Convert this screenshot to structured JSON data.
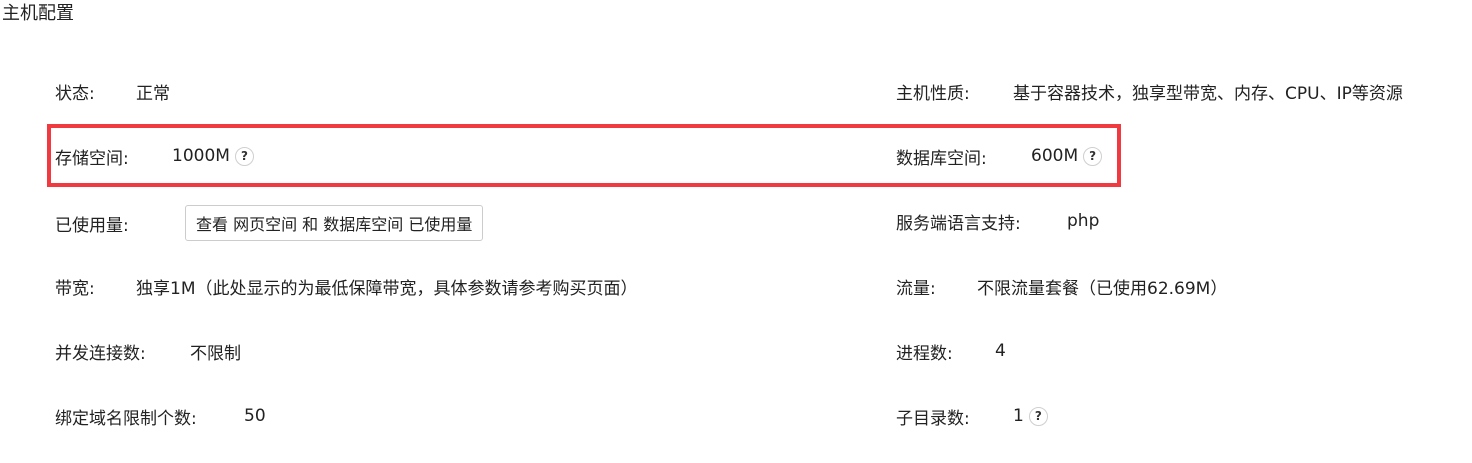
{
  "section": {
    "title": "主机配置"
  },
  "left": {
    "status": {
      "label": "状态:",
      "value": "正常"
    },
    "storage": {
      "label": "存储空间:",
      "value": "1000M",
      "help": "?"
    },
    "usage": {
      "label": "已使用量:",
      "button_label": "查看 网页空间 和 数据库空间 已使用量"
    },
    "bandwidth": {
      "label": "带宽:",
      "value": "独享1M（此处显示的为最低保障带宽，具体参数请参考购买页面）"
    },
    "concurrency": {
      "label": "并发连接数:",
      "value": "不限制"
    },
    "domains": {
      "label": "绑定域名限制个数:",
      "value": "50"
    }
  },
  "right": {
    "host_type": {
      "label": "主机性质:",
      "value": "基于容器技术，独享型带宽、内存、CPU、IP等资源"
    },
    "database": {
      "label": "数据库空间:",
      "value": "600M",
      "help": "?"
    },
    "language": {
      "label": "服务端语言支持:",
      "value": "php"
    },
    "traffic": {
      "label": "流量:",
      "value": "不限流量套餐（已使用62.69M）"
    },
    "processes": {
      "label": "进程数:",
      "value": "4"
    },
    "subdirs": {
      "label": "子目录数:",
      "value": "1",
      "help": "?"
    }
  },
  "colors": {
    "highlight": "#f03a3f",
    "text": "#222222",
    "button_border": "#cccccc"
  }
}
